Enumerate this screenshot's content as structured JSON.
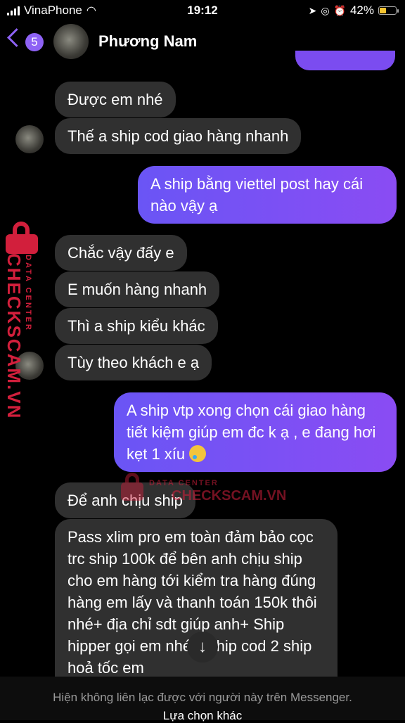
{
  "status_bar": {
    "carrier": "VinaPhone",
    "time": "19:12",
    "battery_percent": "42%",
    "battery_level": 0.42
  },
  "header": {
    "unread_count": "5",
    "contact_name": "Phương Nam"
  },
  "messages": [
    {
      "side": "in",
      "text": "Được em nhé"
    },
    {
      "side": "in",
      "text": "Thế a ship cod giao hàng nhanh"
    },
    {
      "side": "out",
      "text": "A ship bằng viettel post hay cái nào vậy ạ"
    },
    {
      "side": "in",
      "text": "Chắc vậy đấy e"
    },
    {
      "side": "in",
      "text": "E muốn hàng nhanh"
    },
    {
      "side": "in",
      "text": "Thì a ship kiểu khác"
    },
    {
      "side": "in",
      "text": "Tùy theo khách e ạ"
    },
    {
      "side": "out",
      "text": "A ship vtp xong chọn cái giao hàng tiết kiệm giúp em đc k ạ , e đang hơi kẹt 1 xíu"
    },
    {
      "side": "in",
      "text": "Để anh chịu ship"
    },
    {
      "side": "in",
      "text": "Pass xlim pro em toàn đảm bảo cọc trc ship 100k để bên anh chịu ship cho em hàng tới  kiểm tra hàng đúng hàng em lấy và thanh toán 150k thôi nhé+ địa chỉ sdt giúp anh+ Ship        hipper gọi em nhé 1 ship cod 2 ship hoả tốc em"
    }
  ],
  "watermark": {
    "brand": "CHECKSCAM.VN",
    "subtitle": "DATA CENTER",
    "color": "#d21f3c"
  },
  "footer": {
    "notice": "Hiện không liên lạc được với người này trên Messenger.",
    "action": "Lựa chọn khác"
  },
  "colors": {
    "accent": "#8e62f5",
    "incoming_bubble": "#303030",
    "outgoing_bubble": "#7b4cf0"
  }
}
